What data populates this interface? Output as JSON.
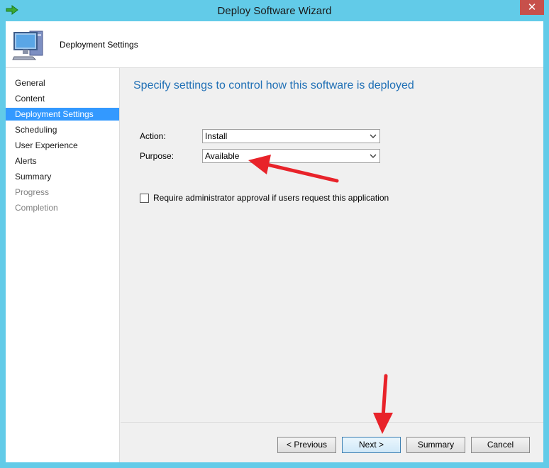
{
  "window": {
    "title": "Deploy Software Wizard",
    "close_glyph": "✕"
  },
  "header": {
    "title": "Deployment Settings",
    "icon": "computer-icon"
  },
  "nav": {
    "items": [
      {
        "label": "General",
        "state": "normal"
      },
      {
        "label": "Content",
        "state": "normal"
      },
      {
        "label": "Deployment Settings",
        "state": "active"
      },
      {
        "label": "Scheduling",
        "state": "normal"
      },
      {
        "label": "User Experience",
        "state": "normal"
      },
      {
        "label": "Alerts",
        "state": "normal"
      },
      {
        "label": "Summary",
        "state": "normal"
      },
      {
        "label": "Progress",
        "state": "disabled"
      },
      {
        "label": "Completion",
        "state": "disabled"
      }
    ]
  },
  "main": {
    "heading": "Specify settings to control how this software is deployed",
    "action": {
      "label": "Action:",
      "value": "Install"
    },
    "purpose": {
      "label": "Purpose:",
      "value": "Available"
    },
    "approval": {
      "label": "Require administrator approval if users request this application",
      "checked": false
    }
  },
  "buttons": {
    "previous": "< Previous",
    "next": "Next >",
    "summary": "Summary",
    "cancel": "Cancel"
  },
  "colors": {
    "accent": "#3399ff",
    "heading": "#1f6fb5",
    "frame": "#62cbe8",
    "annotation": "#e8232a"
  }
}
